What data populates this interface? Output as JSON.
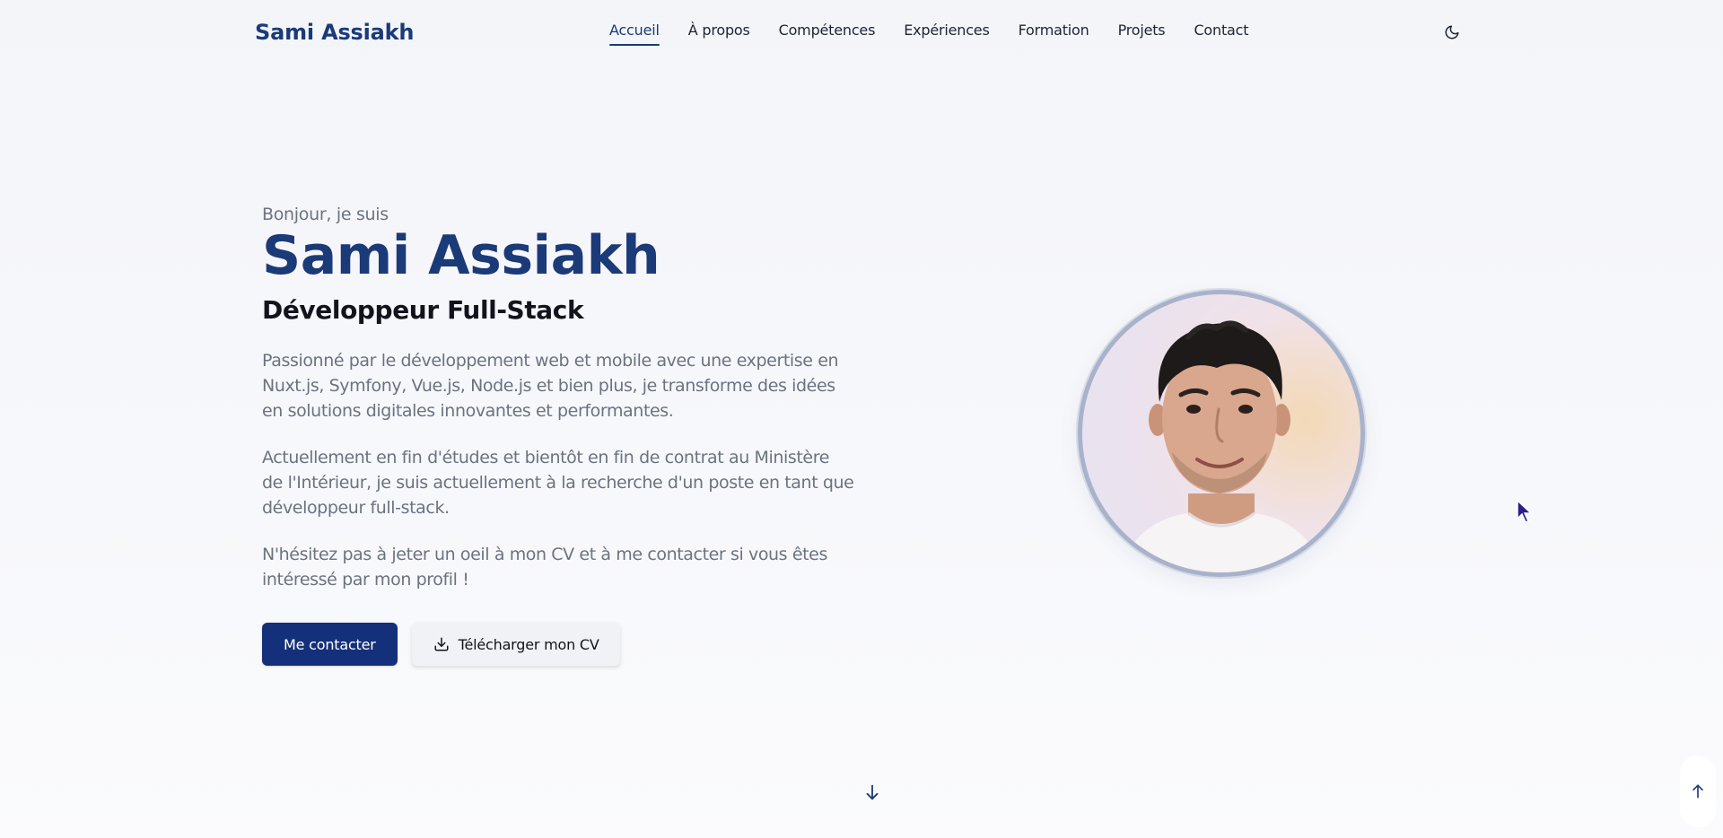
{
  "header": {
    "brand": "Sami Assiakh",
    "nav": [
      {
        "label": "Accueil",
        "active": true
      },
      {
        "label": "À propos",
        "active": false
      },
      {
        "label": "Compétences",
        "active": false
      },
      {
        "label": "Expériences",
        "active": false
      },
      {
        "label": "Formation",
        "active": false
      },
      {
        "label": "Projets",
        "active": false
      },
      {
        "label": "Contact",
        "active": false
      }
    ],
    "theme_toggle_icon": "moon-icon"
  },
  "hero": {
    "greeting": "Bonjour, je suis",
    "name": "Sami Assiakh",
    "role": "Développeur Full-Stack",
    "paragraphs": [
      "Passionné par le développement web et mobile avec une expertise en Nuxt.js, Symfony, Vue.js, Node.js et bien plus, je transforme des idées en solutions digitales innovantes et performantes.",
      "Actuellement en fin d'études et bientôt en fin de contrat au Ministère de l'Intérieur, je suis actuellement à la recherche d'un poste en tant que développeur full-stack.",
      "N'hésitez pas à jeter un oeil à mon CV et à me contacter si vous êtes intéressé par mon profil !"
    ],
    "buttons": {
      "contact": "Me contacter",
      "download_cv": "Télécharger mon CV",
      "download_icon": "download-icon"
    },
    "photo_alt": "portrait"
  },
  "footer_controls": {
    "scroll_down_icon": "arrow-down-icon",
    "back_to_top_icon": "arrow-up-icon"
  },
  "colors": {
    "brand": "#1b3a78",
    "primary_button": "#15307a",
    "muted_text": "#6b7280",
    "avatar_ring": "#a9b2cb"
  }
}
